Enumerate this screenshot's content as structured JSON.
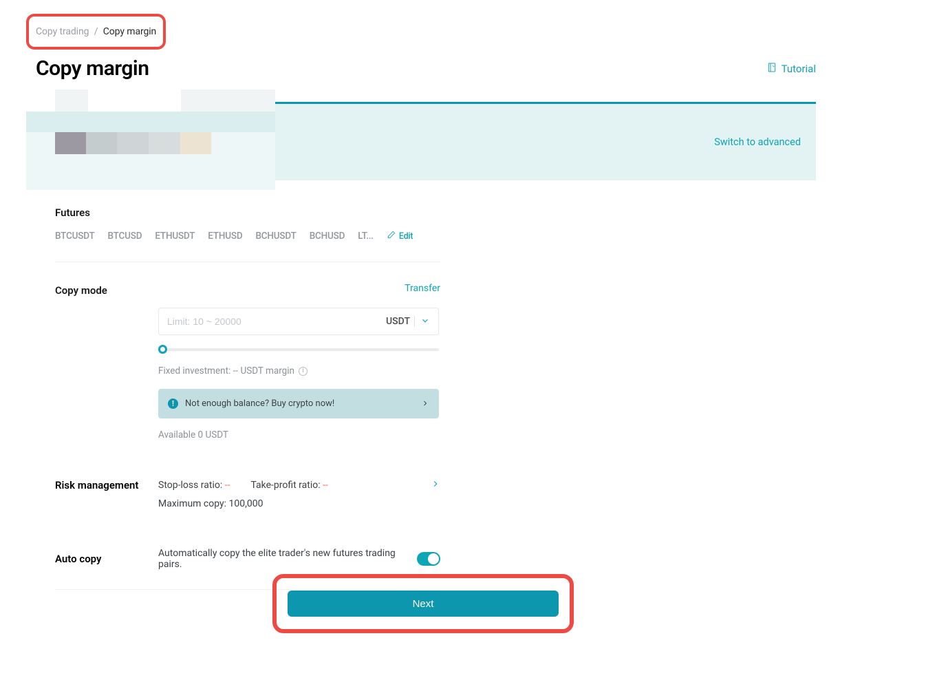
{
  "breadcrumb": {
    "parent": "Copy trading",
    "current": "Copy margin"
  },
  "header": {
    "title": "Copy margin",
    "tutorial_label": "Tutorial"
  },
  "panel": {
    "switch_label": "Switch to advanced"
  },
  "futures": {
    "heading": "Futures",
    "pairs": [
      "BTCUSDT",
      "BTCUSD",
      "ETHUSDT",
      "ETHUSD",
      "BCHUSDT",
      "BCHUSD",
      "LT..."
    ],
    "edit_label": "Edit"
  },
  "copy_mode": {
    "label": "Copy mode",
    "transfer_label": "Transfer",
    "input_placeholder": "Limit: 10 ~ 20000",
    "input_unit": "USDT",
    "fixed_investment_text": "Fixed investment: -- USDT margin",
    "notice_text": "Not enough balance? Buy crypto now!",
    "available_text": "Available 0 USDT"
  },
  "risk": {
    "label": "Risk management",
    "stop_loss_label": "Stop-loss ratio:",
    "stop_loss_value": "--",
    "take_profit_label": "Take-profit ratio:",
    "take_profit_value": "--",
    "max_copy_text": "Maximum copy: 100,000"
  },
  "auto_copy": {
    "label": "Auto copy",
    "description": "Automatically copy the elite trader's new futures trading pairs.",
    "enabled": true
  },
  "next_button": "Next"
}
